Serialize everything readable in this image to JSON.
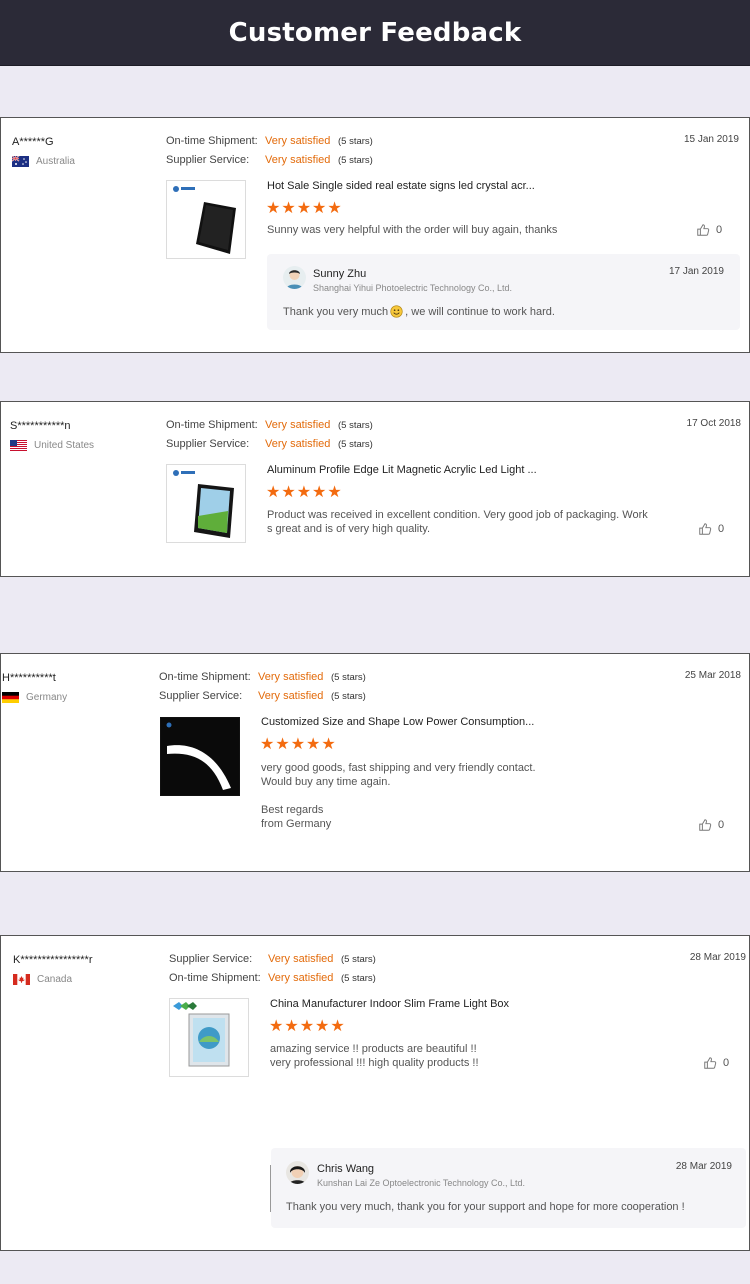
{
  "header": {
    "title": "Customer Feedback"
  },
  "reviews": [
    {
      "user": "A******G",
      "country": "Australia",
      "ratings": [
        {
          "label": "On-time Shipment:",
          "value": "Very satisfied",
          "stars": "(5 stars)"
        },
        {
          "label": "Supplier Service:",
          "value": "Very satisfied",
          "stars": "(5 stars)"
        }
      ],
      "date": "15 Jan 2019",
      "product_title": "Hot Sale Single sided real estate signs led crystal acr...",
      "rating": 5,
      "review_text": "Sunny was very helpful with the order will buy again, thanks",
      "likes": "0",
      "reply": {
        "name": "Sunny Zhu",
        "company": "Shanghai Yihui Photoelectric Technology Co., Ltd.",
        "date": "17 Jan 2019",
        "text_before": "Thank you very much",
        "text_after": ", we will continue to work hard."
      }
    },
    {
      "user": "S***********n",
      "country": "United States",
      "ratings": [
        {
          "label": "On-time Shipment:",
          "value": "Very satisfied",
          "stars": "(5 stars)"
        },
        {
          "label": "Supplier Service:",
          "value": "Very satisfied",
          "stars": "(5 stars)"
        }
      ],
      "date": "17 Oct 2018",
      "product_title": "Aluminum Profile Edge Lit Magnetic Acrylic Led Light ...",
      "rating": 5,
      "review_lines": [
        "Product was received in excellent condition. Very good job of packaging. Work",
        "s great and is of very high quality."
      ],
      "likes": "0"
    },
    {
      "user": "H**********t",
      "country": "Germany",
      "ratings": [
        {
          "label": "On-time Shipment:",
          "value": "Very satisfied",
          "stars": "(5 stars)"
        },
        {
          "label": "Supplier Service:",
          "value": "Very satisfied",
          "stars": "(5 stars)"
        }
      ],
      "date": "25 Mar 2018",
      "product_title": "Customized Size and Shape Low Power Consumption...",
      "rating": 5,
      "review_lines": [
        "very good goods, fast shipping and very friendly contact.",
        "Would buy any time again.",
        "",
        "Best regards",
        "from Germany"
      ],
      "likes": "0"
    },
    {
      "user": "K****************r",
      "country": "Canada",
      "ratings": [
        {
          "label": "Supplier Service:",
          "value": "Very satisfied",
          "stars": "(5 stars)"
        },
        {
          "label": "On-time Shipment:",
          "value": "Very satisfied",
          "stars": "(5 stars)"
        }
      ],
      "date": "28 Mar 2019",
      "product_title": "China Manufacturer Indoor Slim Frame Light Box",
      "rating": 5,
      "review_lines": [
        "amazing service !! products are beautiful !!",
        "very professional !!! high quality products !!"
      ],
      "likes": "0",
      "reply": {
        "name": "Chris Wang",
        "company": "Kunshan Lai Ze Optoelectronic Technology Co., Ltd.",
        "date": "28 Mar 2019",
        "text": "Thank you very much, thank you for your support and hope for more cooperation !"
      }
    }
  ],
  "colors": {
    "accent": "#e36b0b",
    "star": "#f36b10",
    "header_bg": "#2b2a37"
  },
  "icons": {
    "like": "thumbs-up-icon",
    "star": "star-icon",
    "smiley": "smiley-emoji-icon"
  }
}
